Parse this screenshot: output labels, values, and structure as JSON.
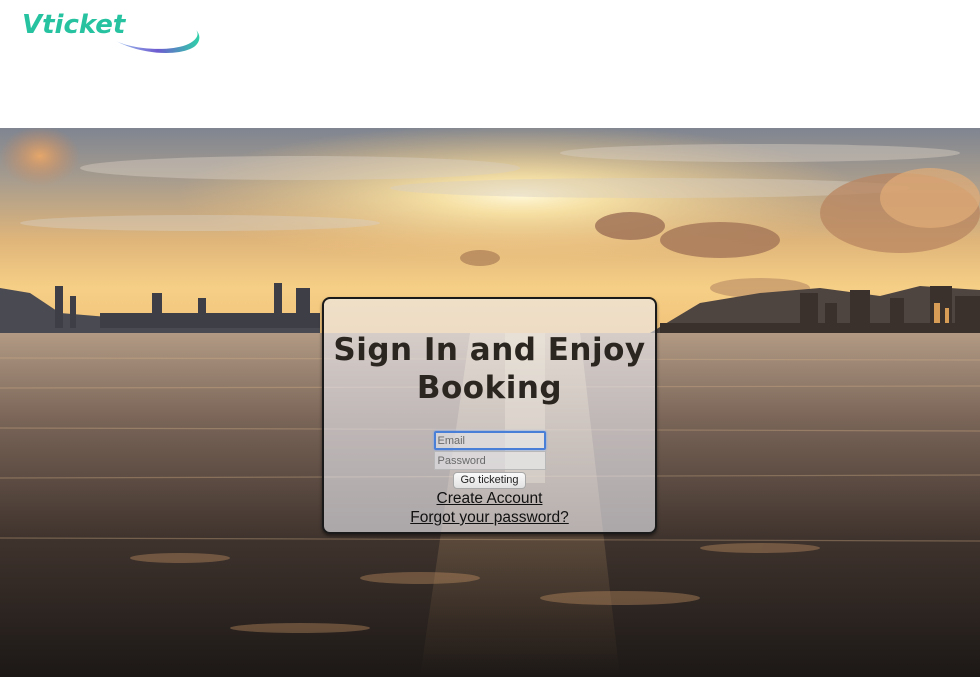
{
  "brand": {
    "name": "Vticket",
    "text_color": "#27c3a0",
    "swoosh_colors": [
      "#6d5bd0",
      "#a7c8f0",
      "#2fd0a8"
    ]
  },
  "hero": {
    "description_colors": {
      "sky_top": "#8a8e96",
      "sun": "#fff3c4",
      "water_dark": "#1f1a18"
    }
  },
  "login": {
    "title": "Sign In and Enjoy Booking",
    "email_placeholder": "Email",
    "password_placeholder": "Password",
    "submit_label": "Go ticketing",
    "create_account_label": "Create Account",
    "forgot_password_label": "Forgot your password?",
    "focused_field": "email"
  },
  "icons": {
    "logo_swoosh": "swoosh-icon"
  }
}
